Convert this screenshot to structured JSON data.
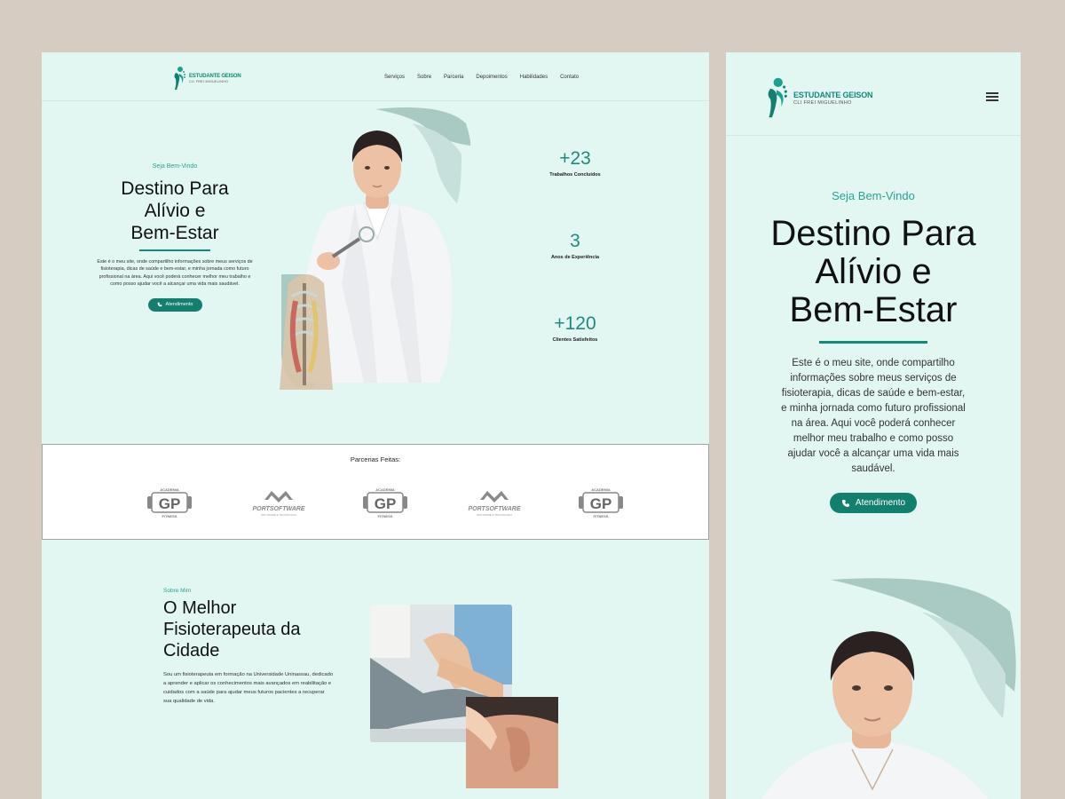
{
  "brand": {
    "name": "ESTUDANTE GEISON",
    "tagline": "CLI FREI MIGUELINHO"
  },
  "nav": {
    "items": [
      "Serviços",
      "Sobre",
      "Parceria",
      "Depoimentos",
      "Habilidades",
      "Contato"
    ]
  },
  "hero": {
    "welcome": "Seja Bem-Vindo",
    "title_lines": [
      "Destino Para",
      "Alívio e",
      "Bem-Estar"
    ],
    "text": "Este é o meu site, onde compartilho informações sobre meus serviços de fisioterapia, dicas de saúde e bem-estar, e minha jornada como futuro profissional na área. Aqui você poderá conhecer melhor meu trabalho e como posso ajudar você a alcançar uma vida mais saudável.",
    "button": "Atendimento"
  },
  "stats": [
    {
      "value": "+23",
      "label": "Trabalhos Concluídos"
    },
    {
      "value": "3",
      "label": "Anos de Experiência"
    },
    {
      "value": "+120",
      "label": "Clientes Satisfeitos"
    }
  ],
  "partners": {
    "title": "Parcerias Feitas:",
    "logos": [
      {
        "name": "GP",
        "caption": "FITNESS",
        "top": "ACADEMIA"
      },
      {
        "name": "PORTSOFTWARE",
        "caption": "SOFTWARE E TECNOLOGIA"
      },
      {
        "name": "GP",
        "caption": "FITNESS",
        "top": "ACADEMIA"
      },
      {
        "name": "PORTSOFTWARE",
        "caption": "SOFTWARE E TECNOLOGIA"
      },
      {
        "name": "GP",
        "caption": "FITNESS",
        "top": "ACADEMIA"
      }
    ]
  },
  "about": {
    "kicker": "Sobre Mim",
    "title_lines": [
      "O Melhor",
      "Fisioterapeuta da",
      "Cidade"
    ],
    "text": "Sou um fisioterapeuta em formação na Universidade Uninassau, dedicado a aprender e aplicar os conhecimentos mais avançados em reabilitação e cuidados com a saúde para ajudar meus futuros pacientes a recuperar sua qualidade de vida."
  },
  "colors": {
    "accent": "#137f6f",
    "background": "#e2f6f2",
    "page": "#d6ccc2"
  },
  "icons": {
    "phone": "phone-icon",
    "menu": "hamburger-menu-icon"
  }
}
